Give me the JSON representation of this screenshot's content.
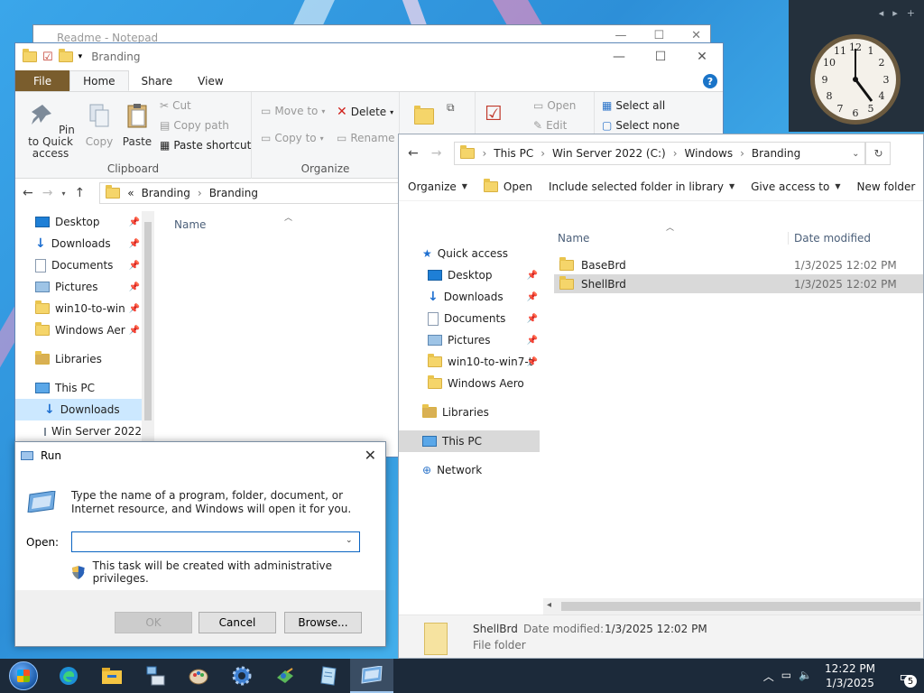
{
  "notepad": {
    "title": "Readme - Notepad"
  },
  "explorer1": {
    "title": "Branding",
    "tabs": {
      "file": "File",
      "home": "Home",
      "share": "Share",
      "view": "View"
    },
    "clipboard": {
      "pin_label": "Pin to Quick access",
      "copy_label": "Copy",
      "paste_label": "Paste",
      "cut_label": "Cut",
      "copy_path_label": "Copy path",
      "paste_shortcut_label": "Paste shortcut",
      "group_label": "Clipboard"
    },
    "organize": {
      "move_to_label": "Move to",
      "copy_to_label": "Copy to",
      "delete_label": "Delete",
      "rename_label": "Rename",
      "group_label": "Organize"
    },
    "open": {
      "open_label": "Open",
      "edit_label": "Edit"
    },
    "select": {
      "select_all_label": "Select all",
      "select_none_label": "Select none"
    },
    "breadcrumb": {
      "prefix": "«",
      "part1": "Branding",
      "part2": "Branding"
    },
    "column_name": "Name",
    "nav_items": [
      {
        "label": "Desktop"
      },
      {
        "label": "Downloads"
      },
      {
        "label": "Documents"
      },
      {
        "label": "Pictures"
      },
      {
        "label": "win10-to-win"
      },
      {
        "label": "Windows Aer"
      },
      {
        "label": "Libraries"
      },
      {
        "label": "This PC"
      },
      {
        "label": "Downloads"
      },
      {
        "label": "Win Server 2022"
      }
    ]
  },
  "explorer2": {
    "breadcrumb": [
      "This PC",
      "Win Server 2022 (C:)",
      "Windows",
      "Branding"
    ],
    "commands": {
      "organize": "Organize",
      "open": "Open",
      "include": "Include selected folder in library",
      "share": "Give access to",
      "new_folder": "New folder"
    },
    "nav_items": [
      {
        "label": "Quick access"
      },
      {
        "label": "Desktop"
      },
      {
        "label": "Downloads"
      },
      {
        "label": "Documents"
      },
      {
        "label": "Pictures"
      },
      {
        "label": "win10-to-win7-t"
      },
      {
        "label": "Windows Aero"
      },
      {
        "label": "Libraries"
      },
      {
        "label": "This PC"
      },
      {
        "label": "Network"
      }
    ],
    "columns": {
      "name": "Name",
      "date": "Date modified"
    },
    "files": [
      {
        "name": "BaseBrd",
        "date": "1/3/2025 12:02 PM"
      },
      {
        "name": "ShellBrd",
        "date": "1/3/2025 12:02 PM"
      }
    ],
    "details": {
      "name": "ShellBrd",
      "date_label": "Date modified:",
      "date_value": "1/3/2025 12:02 PM",
      "type": "File folder"
    }
  },
  "run_dialog": {
    "title": "Run",
    "description": "Type the name of a program, folder, document, or Internet resource, and Windows will open it for you.",
    "open_label": "Open:",
    "input_value": "",
    "admin_note": "This task will be created with administrative privileges.",
    "ok_label": "OK",
    "cancel_label": "Cancel",
    "browse_label": "Browse..."
  },
  "taskbar": {
    "time": "12:22 PM",
    "date": "1/3/2025",
    "notification_count": "5"
  },
  "colors": {
    "accent": "#0a64c2",
    "file_tab": "#7a5d2d",
    "selection": "#cce8ff",
    "taskbar": "#1c2a3a"
  }
}
